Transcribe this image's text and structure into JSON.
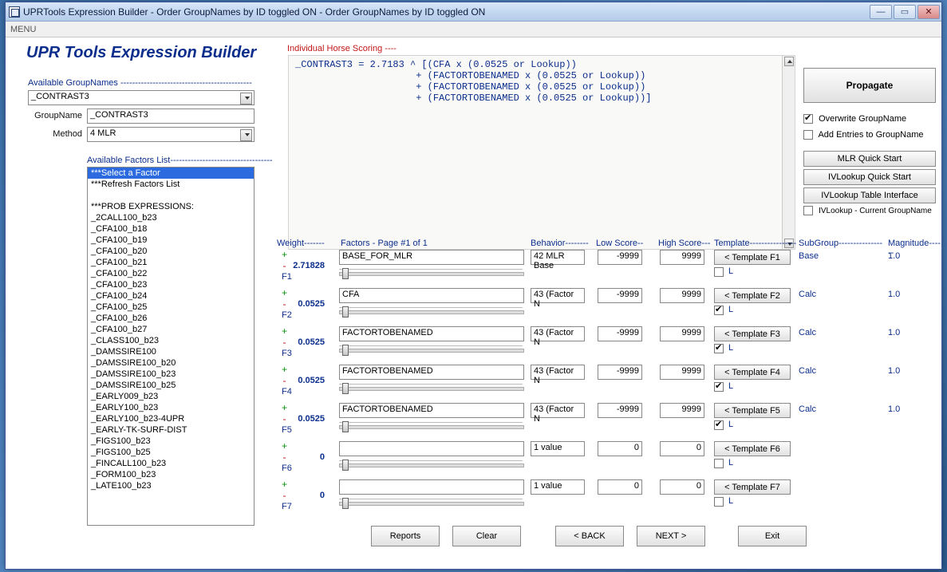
{
  "window": {
    "title": "UPRTools Expression Builder - Order GroupNames by ID toggled ON - Order GroupNames by ID toggled ON"
  },
  "menu": {
    "label": "MENU"
  },
  "app_title": "UPR Tools Expression Builder",
  "left": {
    "available_groupnames_label": "Available GroupNames",
    "groupnames_select": "_CONTRAST3",
    "groupname_label": "GroupName",
    "groupname_value": "_CONTRAST3",
    "method_label": "Method",
    "method_value": "4 MLR",
    "available_factors_label": "Available Factors List",
    "factors_list": [
      "***Select a Factor",
      "***Refresh Factors List",
      "",
      "***PROB EXPRESSIONS:",
      "_2CALL100_b23",
      "_CFA100_b18",
      "_CFA100_b19",
      "_CFA100_b20",
      "_CFA100_b21",
      "_CFA100_b22",
      "_CFA100_b23",
      "_CFA100_b24",
      "_CFA100_b25",
      "_CFA100_b26",
      "_CFA100_b27",
      "_CLASS100_b23",
      "_DAMSSIRE100",
      "_DAMSSIRE100_b20",
      "_DAMSSIRE100_b23",
      "_DAMSSIRE100_b25",
      "_EARLY009_b23",
      "_EARLY100_b23",
      "_EARLY100_b23-4UPR",
      "_EARLY-TK-SURF-DIST",
      "_FIGS100_b23",
      "_FIGS100_b25",
      "_FINCALL100_b23",
      "_FORM100_b23",
      "_LATE100_b23"
    ]
  },
  "formula": {
    "red_header": "Individual Horse Scoring ----",
    "line1": "_CONTRAST3 = 2.7183 ^ [(CFA x (0.0525 or Lookup))",
    "line2": "                     + (FACTORTOBENAMED x (0.0525 or Lookup))",
    "line3": "                     + (FACTORTOBENAMED x (0.0525 or Lookup))",
    "line4": "                     + (FACTORTOBENAMED x (0.0525 or Lookup))]"
  },
  "side": {
    "propagate": "Propagate",
    "overwrite_label": "Overwrite GroupName",
    "addentries_label": "Add Entries to GroupName",
    "mlr_quick": "MLR Quick Start",
    "ivlookup_quick": "IVLookup Quick Start",
    "ivlookup_table": "IVLookup Table Interface",
    "ivlookup_current": "IVLookup - Current GroupName"
  },
  "headers": {
    "weight": "Weight-------",
    "factors": "Factors - Page #1 of 1",
    "behavior": "Behavior--------",
    "low": "Low Score--",
    "high": "High Score---",
    "template": "Template----------------",
    "subgroup": "SubGroup---------------",
    "magnitude": "Magnitude------"
  },
  "rows": [
    {
      "id": "F1",
      "weight": "2.71828",
      "factor": "BASE_FOR_MLR",
      "behavior": "42 MLR Base",
      "low": "-9999",
      "high": "9999",
      "tmpl": "< Template F1",
      "chk": false,
      "sub": "Base",
      "mag": "1.0"
    },
    {
      "id": "F2",
      "weight": "0.0525",
      "factor": "CFA",
      "behavior": "43 (Factor N",
      "low": "-9999",
      "high": "9999",
      "tmpl": "< Template F2",
      "chk": true,
      "sub": "Calc",
      "mag": "1.0"
    },
    {
      "id": "F3",
      "weight": "0.0525",
      "factor": "FACTORTOBENAMED",
      "behavior": "43 (Factor N",
      "low": "-9999",
      "high": "9999",
      "tmpl": "< Template F3",
      "chk": true,
      "sub": "Calc",
      "mag": "1.0"
    },
    {
      "id": "F4",
      "weight": "0.0525",
      "factor": "FACTORTOBENAMED",
      "behavior": "43 (Factor N",
      "low": "-9999",
      "high": "9999",
      "tmpl": "< Template F4",
      "chk": true,
      "sub": "Calc",
      "mag": "1.0"
    },
    {
      "id": "F5",
      "weight": "0.0525",
      "factor": "FACTORTOBENAMED",
      "behavior": "43 (Factor N",
      "low": "-9999",
      "high": "9999",
      "tmpl": "< Template F5",
      "chk": true,
      "sub": "Calc",
      "mag": "1.0"
    },
    {
      "id": "F6",
      "weight": "0",
      "factor": "",
      "behavior": "1 value",
      "low": "0",
      "high": "0",
      "tmpl": "< Template F6",
      "chk": false,
      "sub": "",
      "mag": ""
    },
    {
      "id": "F7",
      "weight": "0",
      "factor": "",
      "behavior": "1 value",
      "low": "0",
      "high": "0",
      "tmpl": "< Template F7",
      "chk": false,
      "sub": "",
      "mag": ""
    }
  ],
  "L_label": "L",
  "bottom": {
    "reports": "Reports",
    "clear": "Clear",
    "back": "< BACK",
    "next": "NEXT >",
    "exit": "Exit"
  }
}
